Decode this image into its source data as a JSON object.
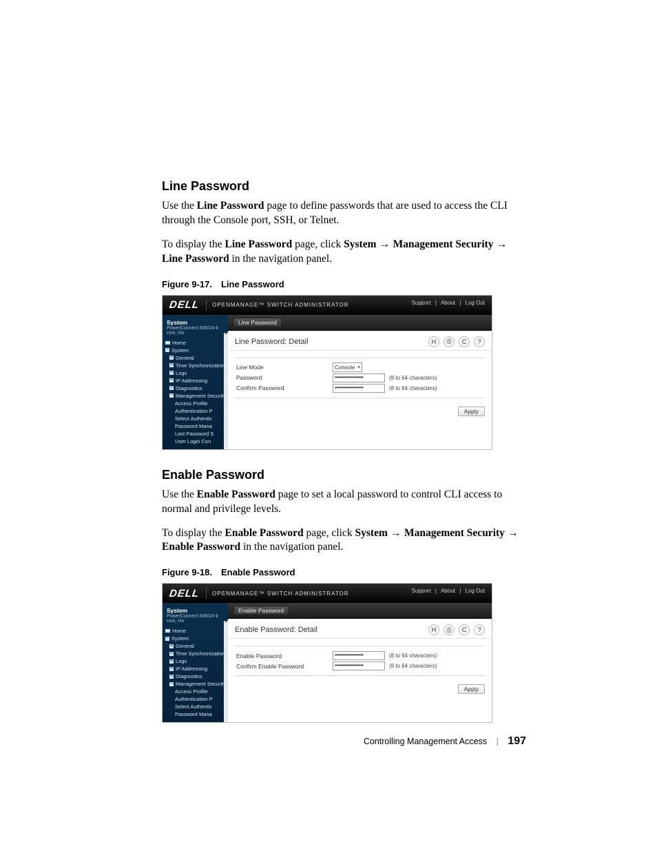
{
  "section1": {
    "heading": "Line Password",
    "para1_a": "Use the ",
    "para1_b": "Line Password",
    "para1_c": " page to define passwords that are used to access the CLI through the Console port, SSH, or Telnet.",
    "para2_a": "To display the ",
    "para2_b": "Line Password",
    "para2_c": " page, click ",
    "para2_d": "System",
    "para2_e": "Management Security",
    "para2_f": "Line Password",
    "para2_g": " in the navigation panel.",
    "caption": "Figure 9-17. Line Password"
  },
  "section2": {
    "heading": "Enable Password",
    "para1_a": "Use the ",
    "para1_b": "Enable Password",
    "para1_c": " page to set a local password to control CLI access to normal and privilege levels.",
    "para2_a": "To display the ",
    "para2_b": "Enable Password",
    "para2_c": " page, click ",
    "para2_d": "System",
    "para2_e": "Management Security",
    "para2_f": "Enable Password",
    "para2_g": " in the navigation panel.",
    "caption": "Figure 9-18. Enable Password"
  },
  "arrows": {
    "r": " → "
  },
  "app": {
    "logo": "DELL",
    "title": "OPENMANAGE™ SWITCH ADMINISTRATOR",
    "links": {
      "support": "Support",
      "about": "About",
      "logout": "Log Out",
      "sep": " | "
    },
    "sidebar_head": {
      "sys": "System",
      "model": "PowerConnect M8024-k",
      "user": "root, r/w"
    },
    "tree": {
      "home": "Home",
      "system": "System",
      "general": "General",
      "timesync": "Time Synchronization",
      "logs": "Logs",
      "ipaddr": "IP Addressing",
      "diag": "Diagnostics",
      "mgmtsec": "Management Security",
      "accessprof": "Access Profile",
      "authprof": "Authentication P",
      "selauth": "Select Authentic",
      "pwmana": "Password Mana",
      "lastpw": "Last Password S",
      "userlogin": "User Login Con"
    },
    "icons": {
      "save": "H",
      "print": "⎙",
      "refresh": "C",
      "help": "?"
    },
    "apply": "Apply",
    "hint": "(8 to 64 characters)",
    "dots": "••••••••••••••••••"
  },
  "shot1": {
    "crumb": "Line Password",
    "detail_title": "Line Password: Detail",
    "rows": {
      "linemode_label": "Line Mode",
      "linemode_value": "Console",
      "password_label": "Password",
      "confirm_label": "Confirm Password"
    }
  },
  "shot2": {
    "crumb": "Enable Password",
    "detail_title": "Enable Password: Detail",
    "rows": {
      "enablepw_label": "Enable Password",
      "confirm_label": "Confirm Enable Password"
    }
  },
  "footer": {
    "title": "Controlling Management Access",
    "page": "197"
  }
}
